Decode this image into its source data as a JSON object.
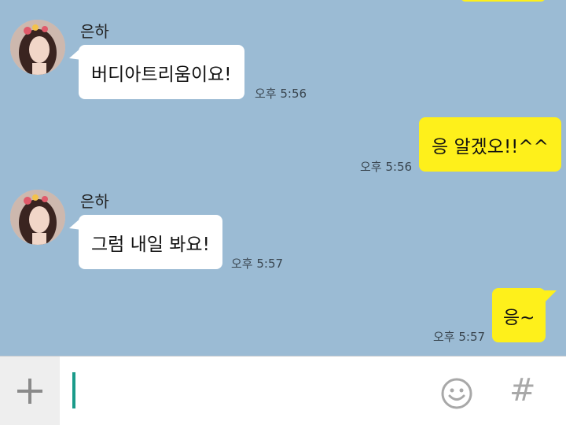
{
  "messages": [
    {
      "sender": "은하",
      "text": "버디아트리움이요!",
      "time": "오후 5:56"
    },
    {
      "text": "응 알겠오!!^^",
      "time": "오후 5:56"
    },
    {
      "sender": "은하",
      "text": "그럼 내일 봐요!",
      "time": "오후 5:57"
    },
    {
      "text": "응~",
      "time": "오후 5:57"
    }
  ],
  "input_bar": {
    "add_icon": "plus-icon",
    "emoji_icon": "smiley-icon",
    "hash_icon": "hash-icon",
    "hash_glyph": "#"
  },
  "colors": {
    "chat_background": "#9bbbd4",
    "outgoing_bubble": "#fef01b",
    "incoming_bubble": "#ffffff",
    "caret": "#1a9b8a"
  }
}
